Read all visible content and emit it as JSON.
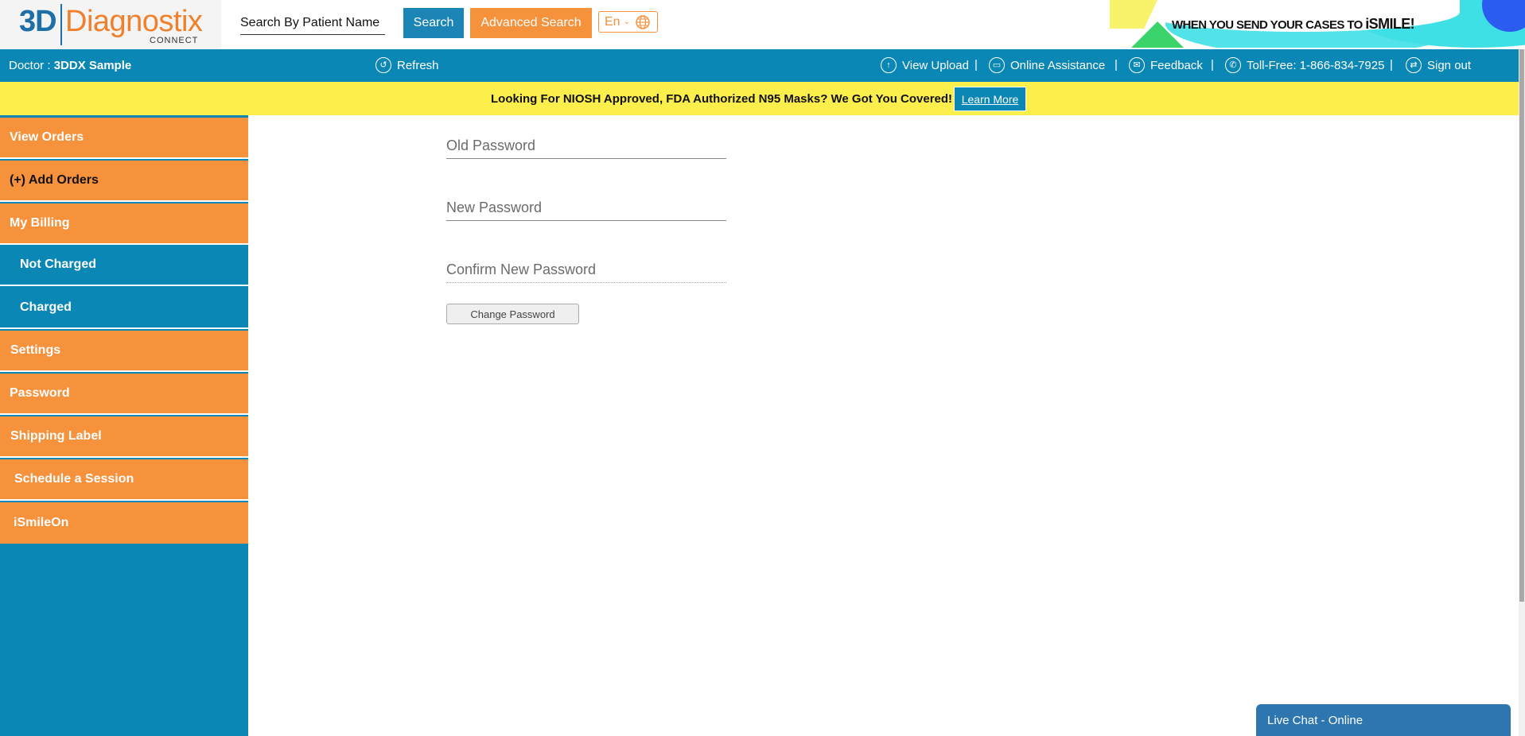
{
  "header": {
    "logo": {
      "part1": "3D",
      "part2": "Diagnostix",
      "sub": "CONNECT"
    },
    "search": {
      "placeholder": "Search By Patient Name",
      "button": "Search"
    },
    "advanced_search": "Advanced Search",
    "language": "En",
    "ad": {
      "text": "WHEN YOU SEND YOUR CASES TO",
      "brand": "iSMILE!"
    }
  },
  "infobar": {
    "doctor_label": "Doctor :",
    "doctor_name": "3DDX Sample",
    "refresh": "Refresh",
    "view_upload": "View Upload",
    "online_assistance": "Online Assistance",
    "feedback": "Feedback",
    "toll_free": "Toll-Free: 1-866-834-7925",
    "sign_out": "Sign out",
    "separator": "|"
  },
  "promo": {
    "text": "Looking For NIOSH Approved, FDA Authorized N95 Masks? We Got You Covered!",
    "button": "Learn More"
  },
  "sidebar": {
    "items": [
      {
        "label": "View Orders"
      },
      {
        "label": "(+) Add Orders"
      },
      {
        "label": "My Billing"
      },
      {
        "label": "Not Charged"
      },
      {
        "label": "Charged"
      },
      {
        "label": "Settings"
      },
      {
        "label": "Password"
      },
      {
        "label": "Shipping Label"
      },
      {
        "label": "Schedule a Session"
      },
      {
        "label": "iSmileOn"
      }
    ]
  },
  "form": {
    "old_password": "Old Password",
    "new_password": "New Password",
    "confirm_password": "Confirm New Password",
    "submit": "Change Password"
  },
  "livechat": {
    "label": "Live Chat - Online"
  },
  "colors": {
    "blue": "#0a87b5",
    "orange": "#f6913c",
    "yellow": "#fcee4b"
  }
}
